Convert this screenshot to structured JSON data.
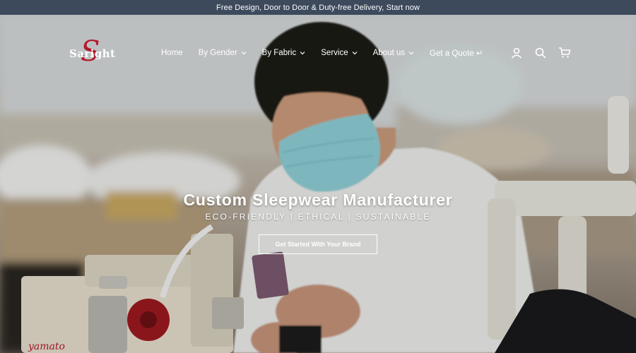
{
  "announcement": {
    "text": "Free Design, Door to Door & Duty-free Delivery, Start now"
  },
  "brand": {
    "logo_text": "Saright",
    "logo_letter": "S",
    "accent_color": "#b3182c"
  },
  "nav": {
    "items": [
      {
        "label": "Home",
        "has_dropdown": false
      },
      {
        "label": "By Gender",
        "has_dropdown": true
      },
      {
        "label": "By Fabric",
        "has_dropdown": true
      },
      {
        "label": "Service",
        "has_dropdown": true
      },
      {
        "label": "About us",
        "has_dropdown": true
      },
      {
        "label": "Get a Quote ↵",
        "has_dropdown": false
      }
    ]
  },
  "header_icons": [
    "account-icon",
    "search-icon",
    "cart-icon"
  ],
  "hero": {
    "title": "Custom Sleepwear Manufacturer",
    "subtitle": "ECO-FRIENDLY | ETHICAL | SUSTAINABLE",
    "cta_label": "Get Started With Your Brand"
  },
  "colors": {
    "announcement_bg": "#3d4a5c",
    "text_on_dark": "#ffffff"
  }
}
